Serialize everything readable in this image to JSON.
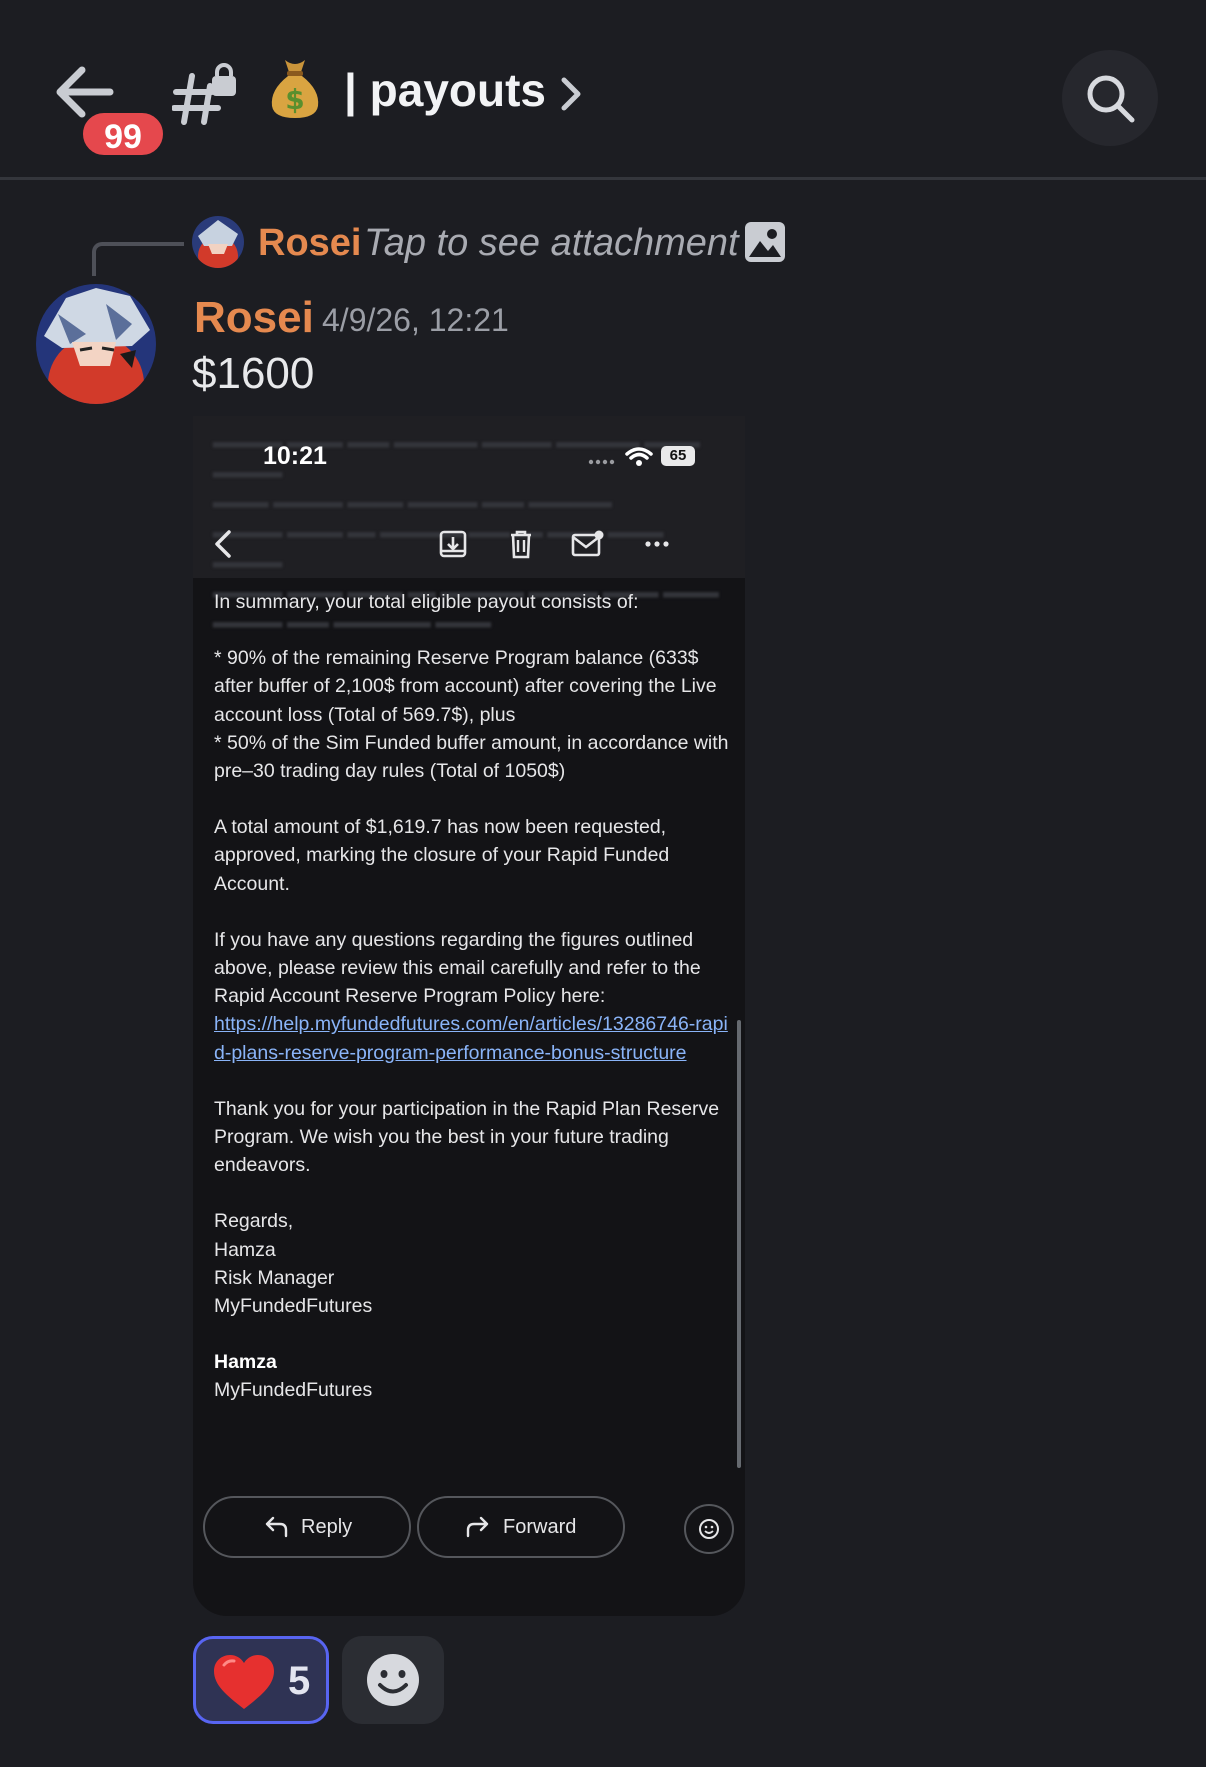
{
  "header": {
    "back_badge": "99",
    "channel_emoji": "money-bag",
    "channel_name": "| payouts",
    "icons": [
      "back-arrow-icon",
      "locked-channel-icon",
      "chevron-right-icon",
      "search-icon"
    ]
  },
  "reply": {
    "author": "Rosei",
    "text": "Tap to see attachment"
  },
  "message": {
    "author": "Rosei",
    "timestamp": "4/9/26, 12:21",
    "text": "$1600",
    "author_color": "#e5894f"
  },
  "attachment": {
    "status_time": "10:21",
    "battery": "65",
    "email": {
      "summary_intro": "In summary, your total eligible payout consists of:",
      "bullet_1": "* 90% of the remaining Reserve Program balance (633$ after buffer of 2,100$ from account) after covering the Live account loss (Total of 569.7$), plus",
      "bullet_2": "* 50% of the Sim Funded buffer amount, in accordance with pre–30 trading day rules (Total of 1050$)",
      "total_paragraph": "A total amount of $1,619.7 has now been requested, approved, marking the closure of your Rapid Funded Account.",
      "questions_paragraph": "If you have any questions regarding the figures outlined above, please review this email carefully and refer to the Rapid Account Reserve Program Policy here:",
      "policy_link": "https://help.myfundedfutures.com/en/articles/13286746-rapid-plans-reserve-program-performance-bonus-structure",
      "thanks_paragraph": "Thank you for your participation in the Rapid Plan Reserve Program. We wish you the best in your future trading endeavors.",
      "regards": "Regards,",
      "sig_name": "Hamza",
      "sig_title": "Risk Manager",
      "sig_company": "MyFundedFutures",
      "footer_name": "Hamza",
      "footer_company": "MyFundedFutures"
    },
    "reply_label": "Reply",
    "forward_label": "Forward"
  },
  "reactions": {
    "heart_count": "5"
  },
  "colors": {
    "background": "#1c1d22",
    "badge": "#e5484d",
    "reaction_border": "#5865f2",
    "link": "#8ab4f8"
  }
}
